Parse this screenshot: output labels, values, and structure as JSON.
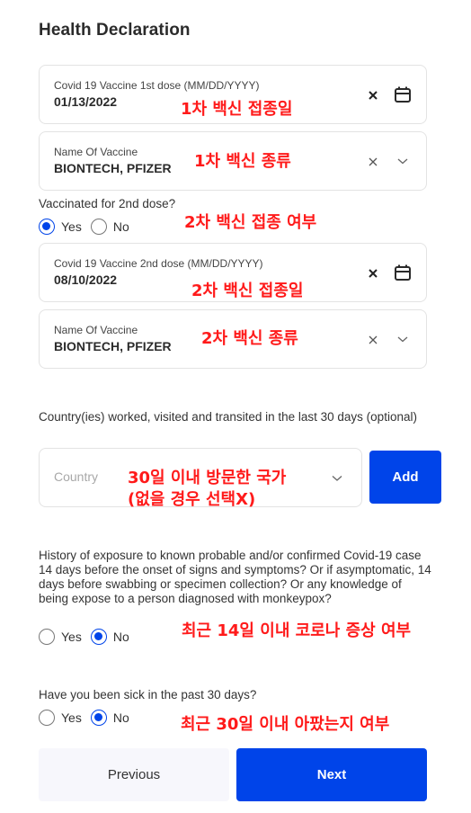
{
  "page": {
    "title": "Health Declaration"
  },
  "colors": {
    "accent": "#0044e9",
    "annotation": "#ff1a1a"
  },
  "fields": {
    "dose1_date": {
      "label": "Covid 19 Vaccine 1st dose (MM/DD/YYYY)",
      "value": "01/13/2022",
      "clear_icon": "close-icon",
      "action_icon": "calendar-icon"
    },
    "dose1_vaccine": {
      "label": "Name Of Vaccine",
      "value": "BIONTECH, PFIZER",
      "clear_icon": "close-icon",
      "action_icon": "chevron-down-icon"
    },
    "dose2_date": {
      "label": "Covid 19 Vaccine 2nd dose (MM/DD/YYYY)",
      "value": "08/10/2022",
      "clear_icon": "close-icon",
      "action_icon": "calendar-icon"
    },
    "dose2_vaccine": {
      "label": "Name Of Vaccine",
      "value": "BIONTECH, PFIZER",
      "clear_icon": "close-icon",
      "action_icon": "chevron-down-icon"
    }
  },
  "questions": {
    "second_dose": {
      "label": "Vaccinated for 2nd dose?",
      "options": [
        "Yes",
        "No"
      ],
      "selected": "Yes"
    },
    "countries": {
      "label": "Country(ies) worked, visited and transited in the last 30 days (optional)",
      "placeholder": "Country",
      "add_label": "Add"
    },
    "exposure": {
      "label": "History of exposure to known probable and/or confirmed Covid-19 case 14 days before the onset of signs and symptoms? Or if asymptomatic, 14 days before swabbing or specimen collection? Or any knowledge of being expose to a person diagnosed with monkeypox?",
      "options": [
        "Yes",
        "No"
      ],
      "selected": "No"
    },
    "sick": {
      "label": "Have you been sick in the past 30 days?",
      "options": [
        "Yes",
        "No"
      ],
      "selected": "No"
    }
  },
  "buttons": {
    "previous": "Previous",
    "next": "Next"
  },
  "annotations": {
    "dose1_date": "1차 백신 접종일",
    "dose1_vaccine": "1차 백신 종류",
    "second_dose": "2차 백신 접종 여부",
    "dose2_date": "2차 백신 접종일",
    "dose2_vaccine": "2차 백신 종류",
    "countries_line1": "30일 이내 방문한 국가",
    "countries_line2": "(없을 경우 선택X)",
    "exposure": "최근 14일 이내 코로나 증상 여부",
    "sick": "최근 30일 이내 아팠는지 여부"
  }
}
